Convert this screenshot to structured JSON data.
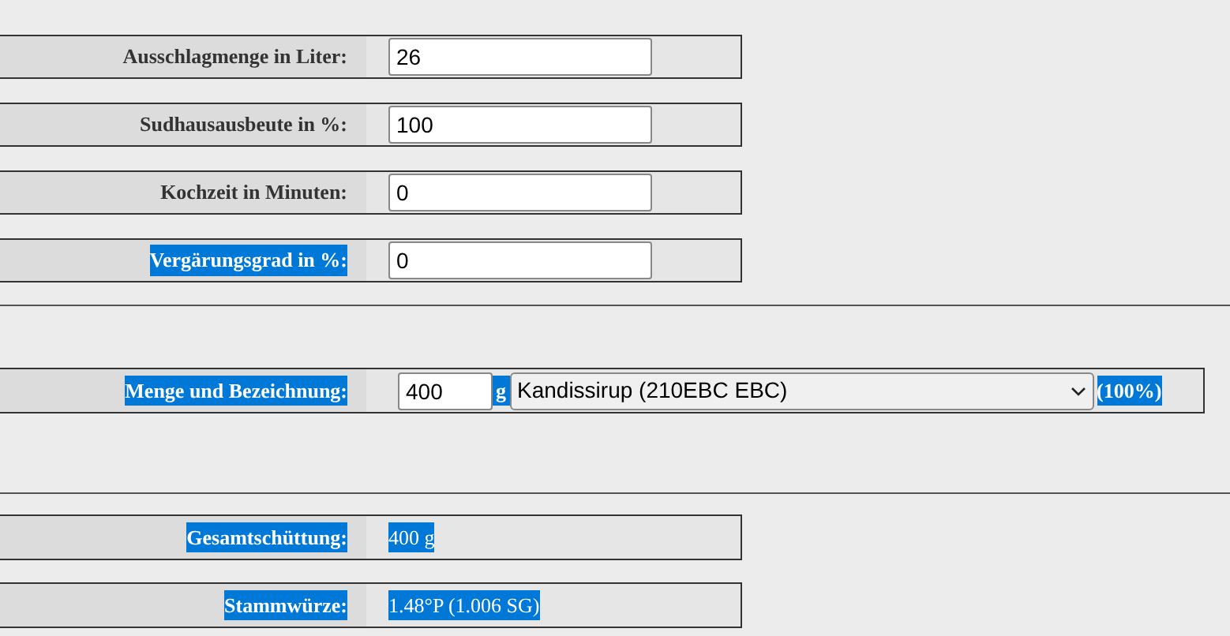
{
  "settings": [
    {
      "label": "Ausschlagmenge in Liter:",
      "highlighted": false,
      "value": "26"
    },
    {
      "label": "Sudhausausbeute in %:",
      "highlighted": false,
      "value": "100"
    },
    {
      "label": "Kochzeit in Minuten:",
      "highlighted": false,
      "value": "0"
    },
    {
      "label": "Vergärungsgrad in %:",
      "highlighted": true,
      "value": "0"
    }
  ],
  "ingredient": {
    "label": "Menge und Bezeichnung:",
    "highlighted": true,
    "amount": "400",
    "unit": "g",
    "unit_highlighted": true,
    "selection": "Kandissirup (210EBC EBC)",
    "share": "(100%)",
    "share_highlighted": true
  },
  "results": [
    {
      "label": "Gesamtschüttung:",
      "highlighted": true,
      "value": "400 g",
      "value_highlighted": true
    },
    {
      "label": "Stammwürze:",
      "highlighted": true,
      "value": "1.48°P (1.006 SG)",
      "value_highlighted": true
    }
  ]
}
